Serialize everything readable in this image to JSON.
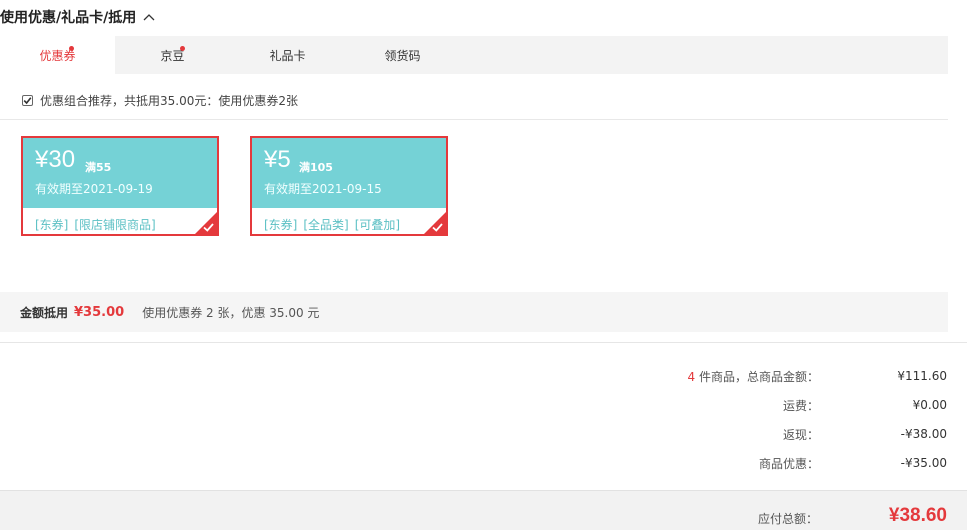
{
  "section": {
    "title": "使用优惠/礼品卡/抵用"
  },
  "tabs": [
    {
      "label": "优惠券",
      "dot": true,
      "active": true
    },
    {
      "label": "京豆",
      "dot": true,
      "active": false
    },
    {
      "label": "礼品卡",
      "dot": false,
      "active": false
    },
    {
      "label": "领货码",
      "dot": false,
      "active": false
    }
  ],
  "recommend": {
    "checked": true,
    "text": "优惠组合推荐，共抵用35.00元：使用优惠券2张"
  },
  "coupons": [
    {
      "amount": "¥30",
      "condition": "满55",
      "expiry": "有效期至2021-09-19",
      "tags": [
        "[东券]",
        "[限店铺限商品]"
      ],
      "selected": true
    },
    {
      "amount": "¥5",
      "condition": "满105",
      "expiry": "有效期至2021-09-15",
      "tags": [
        "[东券]",
        "[全品类]",
        "[可叠加]"
      ],
      "selected": true
    }
  ],
  "summary": {
    "label": "金额抵用",
    "amount": "¥35.00",
    "detail": "使用优惠券 2 张，优惠 35.00 元"
  },
  "prices": {
    "item_count": "4",
    "goods_label": " 件商品，总商品金额：",
    "goods_value": "¥111.60",
    "shipping_label": "运费：",
    "shipping_value": "¥0.00",
    "cashback_label": "返现：",
    "cashback_value": "-¥38.00",
    "discount_label": "商品优惠：",
    "discount_value": "-¥35.00"
  },
  "total": {
    "label": "应付总额：",
    "value": "¥38.60"
  },
  "colors": {
    "accent": "#e4393c",
    "coupon": "#75d2d6",
    "coupon_tag": "#5cc0c4"
  }
}
